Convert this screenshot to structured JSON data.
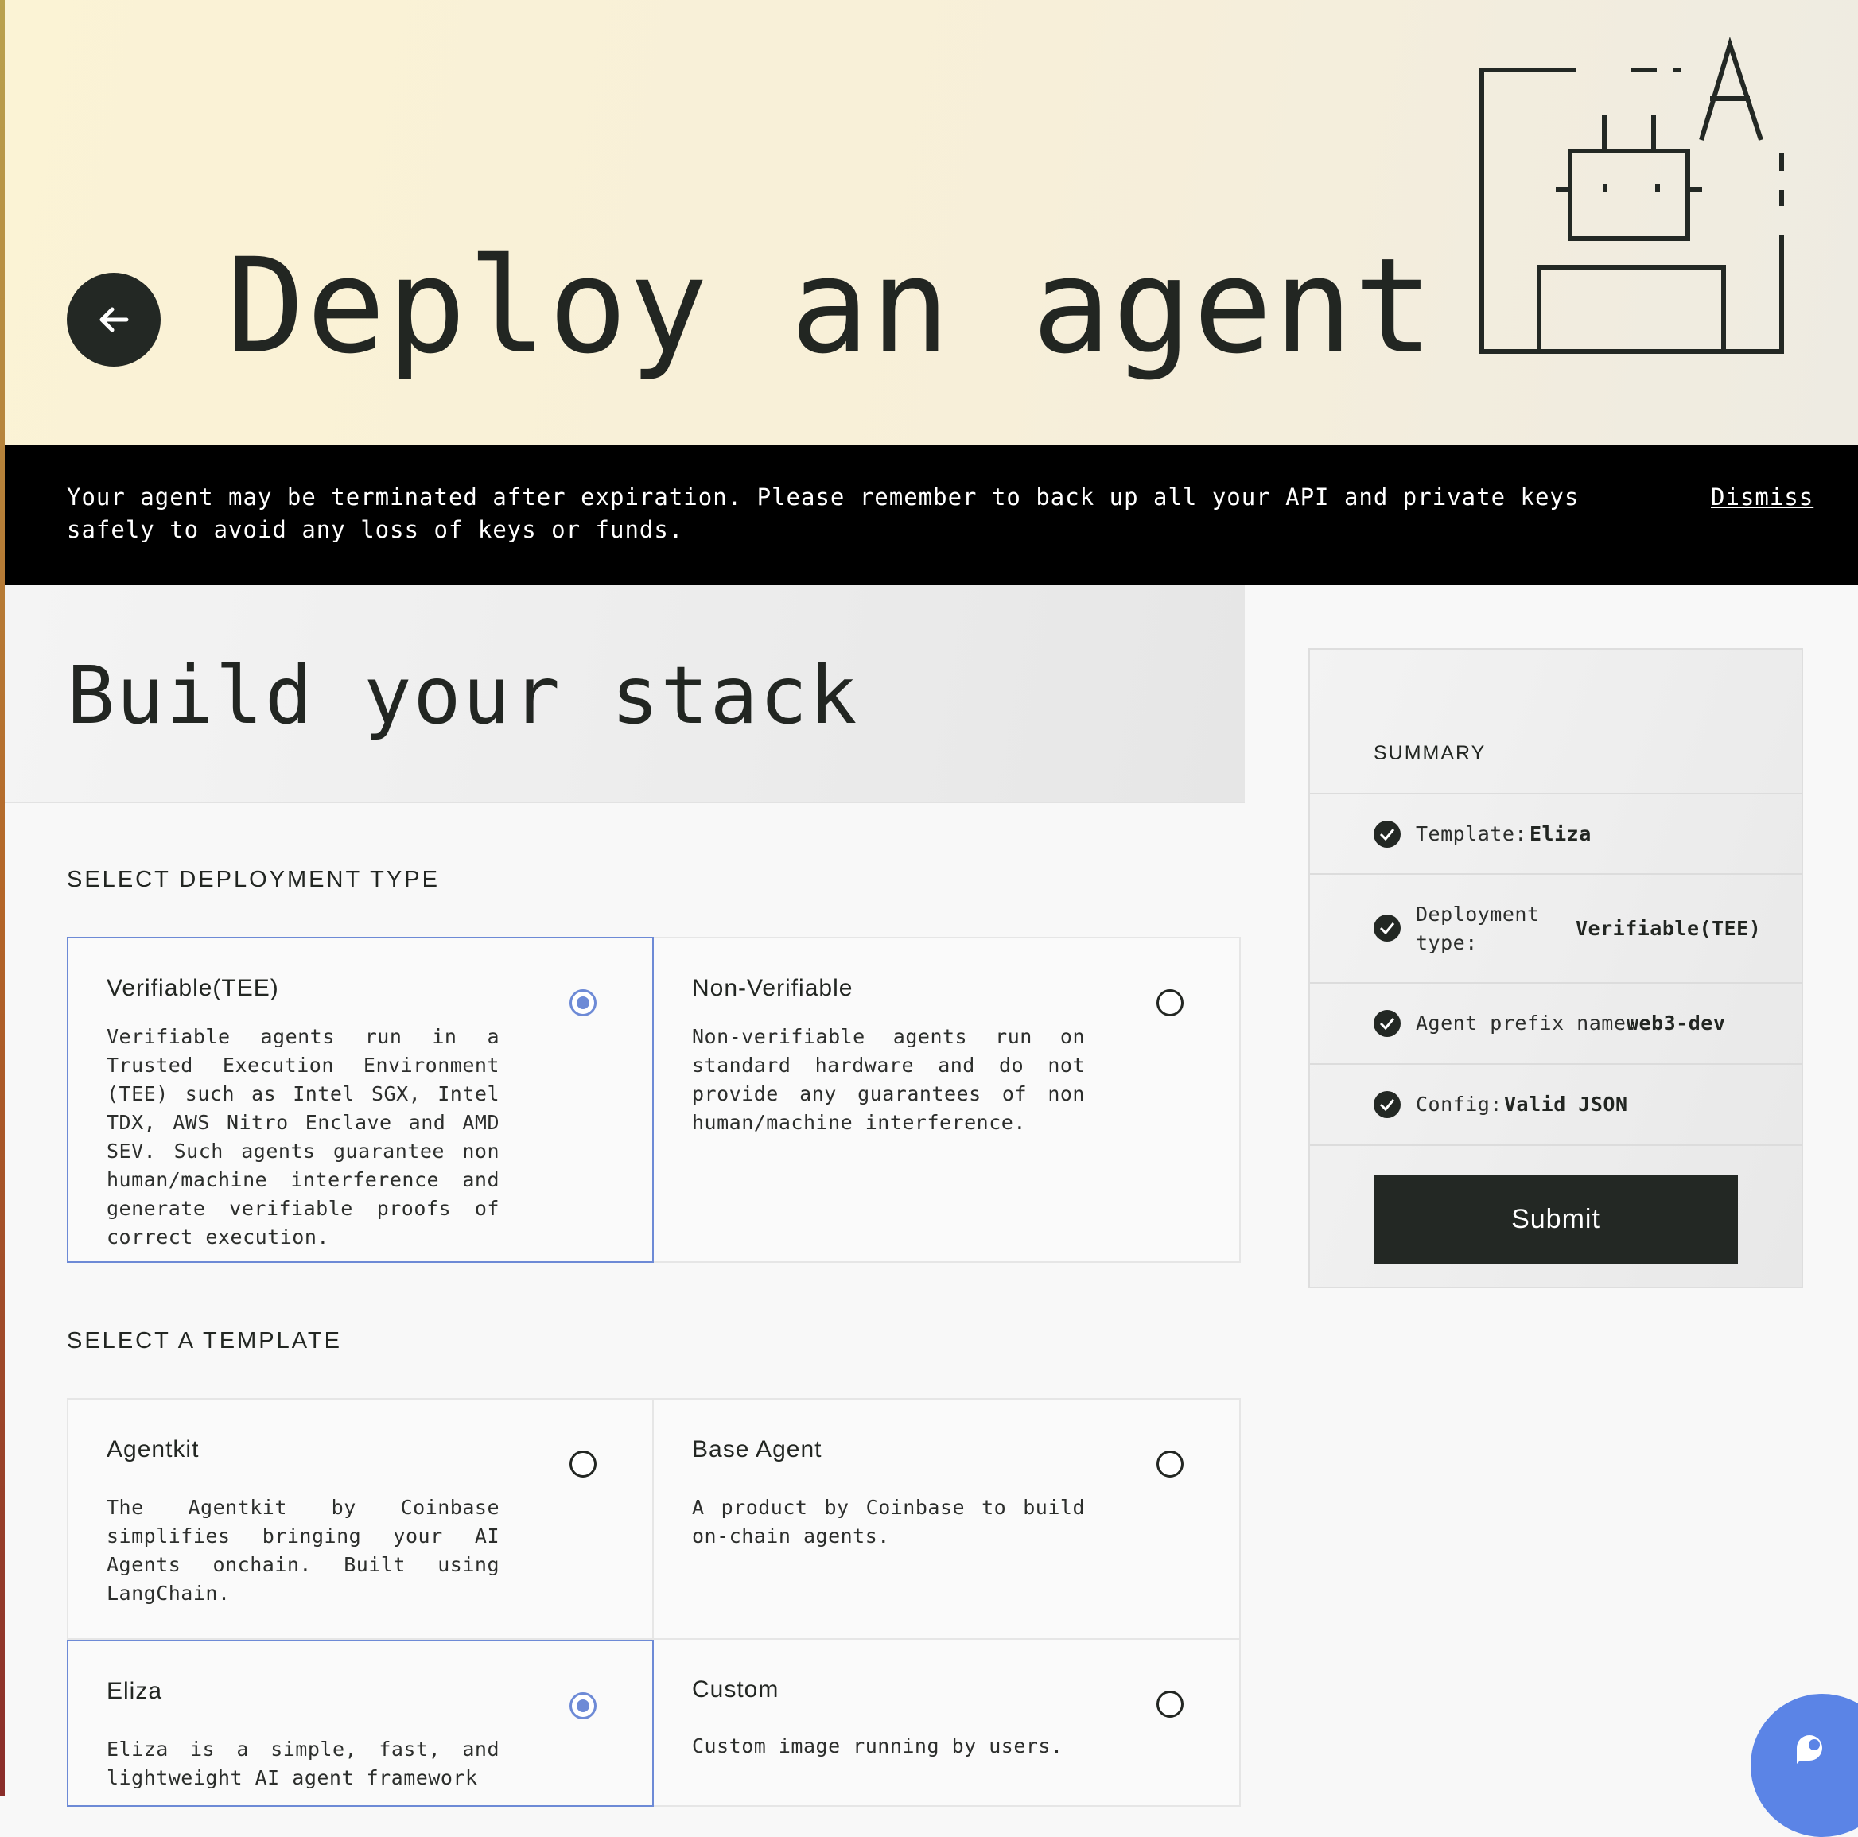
{
  "hero": {
    "title": "Deploy an agent",
    "back_icon": "arrow-left-icon"
  },
  "banner": {
    "message": "Your agent may be terminated after expiration. Please remember to back up all your API and private keys safely to avoid any loss of keys or funds.",
    "dismiss_label": "Dismiss"
  },
  "stack": {
    "title": "Build your stack"
  },
  "deployment": {
    "label": "SELECT DEPLOYMENT TYPE",
    "options": [
      {
        "title": "Verifiable(TEE)",
        "description": "Verifiable agents run in a Trusted Execution Environment (TEE) such as Intel SGX, Intel TDX, AWS Nitro Enclave and AMD SEV. Such agents guarantee non human/machine interference and generate verifiable proofs of correct execution.",
        "selected": true
      },
      {
        "title": "Non-Verifiable",
        "description": "Non-verifiable agents run on standard hardware and do not provide any guarantees of non human/machine interference.",
        "selected": false
      }
    ]
  },
  "template": {
    "label": "SELECT A TEMPLATE",
    "options": [
      {
        "title": "Agentkit",
        "description": "The Agentkit by Coinbase simplifies bringing your AI Agents onchain. Built using LangChain.",
        "selected": false
      },
      {
        "title": "Base Agent",
        "description": "A product by Coinbase to build on-chain agents.",
        "selected": false
      },
      {
        "title": "Eliza",
        "description": "Eliza is a simple, fast, and lightweight AI agent framework",
        "selected": true
      },
      {
        "title": "Custom",
        "description": "Custom image running by users.",
        "selected": false
      }
    ]
  },
  "summary": {
    "title": "SUMMARY",
    "rows": [
      {
        "label": "Template:",
        "value": "Eliza"
      },
      {
        "label": "Deployment type:",
        "value": "Verifiable(TEE)"
      },
      {
        "label": "Agent prefix name:",
        "value": "web3-dev"
      },
      {
        "label": "Config:",
        "value": "Valid JSON"
      }
    ],
    "submit_label": "Submit"
  },
  "colors": {
    "accent": "#6d8ad6",
    "dark": "#232824",
    "chat": "#5b84e6"
  }
}
